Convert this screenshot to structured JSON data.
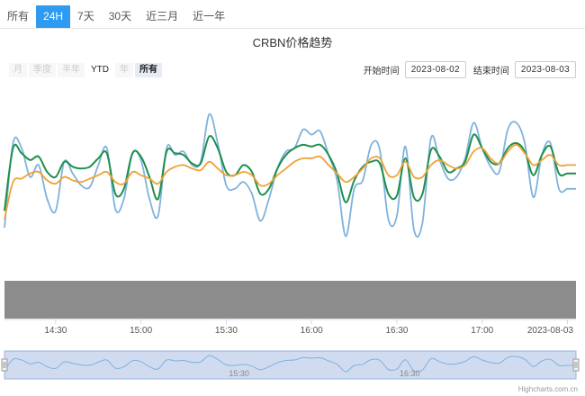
{
  "tabs": [
    {
      "label": "所有",
      "active": false
    },
    {
      "label": "24H",
      "active": true
    },
    {
      "label": "7天",
      "active": false
    },
    {
      "label": "30天",
      "active": false
    },
    {
      "label": "近三月",
      "active": false
    },
    {
      "label": "近一年",
      "active": false
    }
  ],
  "range_buttons": [
    {
      "label": "月",
      "state": "disabled"
    },
    {
      "label": "季度",
      "state": "disabled"
    },
    {
      "label": "半年",
      "state": "disabled"
    },
    {
      "label": "YTD",
      "state": "enabled"
    },
    {
      "label": "年",
      "state": "disabled"
    },
    {
      "label": "所有",
      "state": "selected"
    }
  ],
  "date_range": {
    "start_label": "开始时间",
    "start_value": "2023-08-02",
    "end_label": "结束时间",
    "end_value": "2023-08-03"
  },
  "credit": "Highcharts.com.cn",
  "colors": {
    "accent": "#2e9bf0",
    "light_blue": "#7fb2dd",
    "green": "#1f8f4c",
    "orange": "#f0a236",
    "volume": "#8c8c8c",
    "navigator_fill": "#d0dbf0"
  },
  "chart_data": {
    "type": "line",
    "title": "CRBN价格趋势",
    "x_tick_labels": [
      "14:30",
      "15:00",
      "15:30",
      "16:00",
      "16:30",
      "17:00",
      "2023-08-03"
    ],
    "x_tick_hours": [
      14.5,
      15.0,
      15.5,
      16.0,
      16.5,
      17.0,
      17.5
    ],
    "x_range": [
      14.2,
      17.55
    ],
    "x": [
      14.2,
      14.25,
      14.3,
      14.35,
      14.4,
      14.45,
      14.5,
      14.55,
      14.6,
      14.65,
      14.7,
      14.75,
      14.8,
      14.85,
      14.9,
      14.95,
      15.0,
      15.05,
      15.1,
      15.15,
      15.2,
      15.25,
      15.3,
      15.35,
      15.4,
      15.45,
      15.5,
      15.55,
      15.6,
      15.65,
      15.7,
      15.75,
      15.8,
      15.85,
      15.9,
      15.95,
      16.0,
      16.05,
      16.1,
      16.15,
      16.2,
      16.25,
      16.3,
      16.35,
      16.4,
      16.45,
      16.5,
      16.55,
      16.6,
      16.65,
      16.7,
      16.75,
      16.8,
      16.85,
      16.9,
      16.95,
      17.0,
      17.05,
      17.1,
      17.15,
      17.2,
      17.25,
      17.3,
      17.35,
      17.4,
      17.45,
      17.5,
      17.55
    ],
    "y_range": [
      0,
      100
    ],
    "y_axis_labels": "none",
    "grid": false,
    "legend": "none",
    "series": [
      {
        "color": "#7fb2dd",
        "values": [
          25,
          75,
          72,
          55,
          62,
          42,
          35,
          64,
          57,
          50,
          49,
          62,
          72,
          36,
          42,
          69,
          65,
          42,
          32,
          72,
          68,
          70,
          62,
          64,
          92,
          75,
          50,
          48,
          52,
          45,
          29,
          42,
          60,
          70,
          72,
          83,
          80,
          82,
          68,
          53,
          20,
          48,
          53,
          74,
          71,
          30,
          32,
          73,
          24,
          28,
          78,
          65,
          54,
          55,
          66,
          87,
          72,
          61,
          58,
          83,
          87,
          75,
          43,
          68,
          75,
          48,
          48,
          48
        ]
      },
      {
        "color": "#1f8f4c",
        "values": [
          35,
          72,
          69,
          65,
          67,
          58,
          55,
          64,
          61,
          60,
          61,
          66,
          69,
          45,
          48,
          69,
          67,
          55,
          42,
          70,
          69,
          68,
          63,
          63,
          79,
          72,
          58,
          56,
          62,
          58,
          45,
          48,
          60,
          68,
          72,
          74,
          73,
          74,
          68,
          57,
          40,
          53,
          61,
          64,
          63,
          45,
          44,
          66,
          43,
          45,
          71,
          67,
          58,
          60,
          64,
          80,
          72,
          64,
          63,
          72,
          75,
          70,
          56,
          68,
          73,
          57,
          57,
          57
        ]
      },
      {
        "color": "#f0a236",
        "values": [
          30,
          52,
          54,
          57,
          58,
          53,
          51,
          55,
          53,
          52,
          54,
          56,
          58,
          52,
          51,
          58,
          56,
          54,
          51,
          58,
          61,
          62,
          60,
          59,
          64,
          60,
          56,
          56,
          58,
          56,
          50,
          51,
          56,
          60,
          64,
          66,
          66,
          67,
          62,
          57,
          52,
          55,
          60,
          66,
          66,
          56,
          56,
          64,
          55,
          55,
          62,
          65,
          62,
          60,
          62,
          70,
          72,
          66,
          63,
          70,
          74,
          69,
          62,
          65,
          68,
          62,
          62,
          62
        ]
      }
    ],
    "volume": "uniform gray bars across full range",
    "navigator": {
      "series_color": "#7fb2dd",
      "x_tick_labels": [
        "15:30",
        "16:30"
      ],
      "x_tick_hours": [
        15.5,
        16.5
      ]
    }
  }
}
